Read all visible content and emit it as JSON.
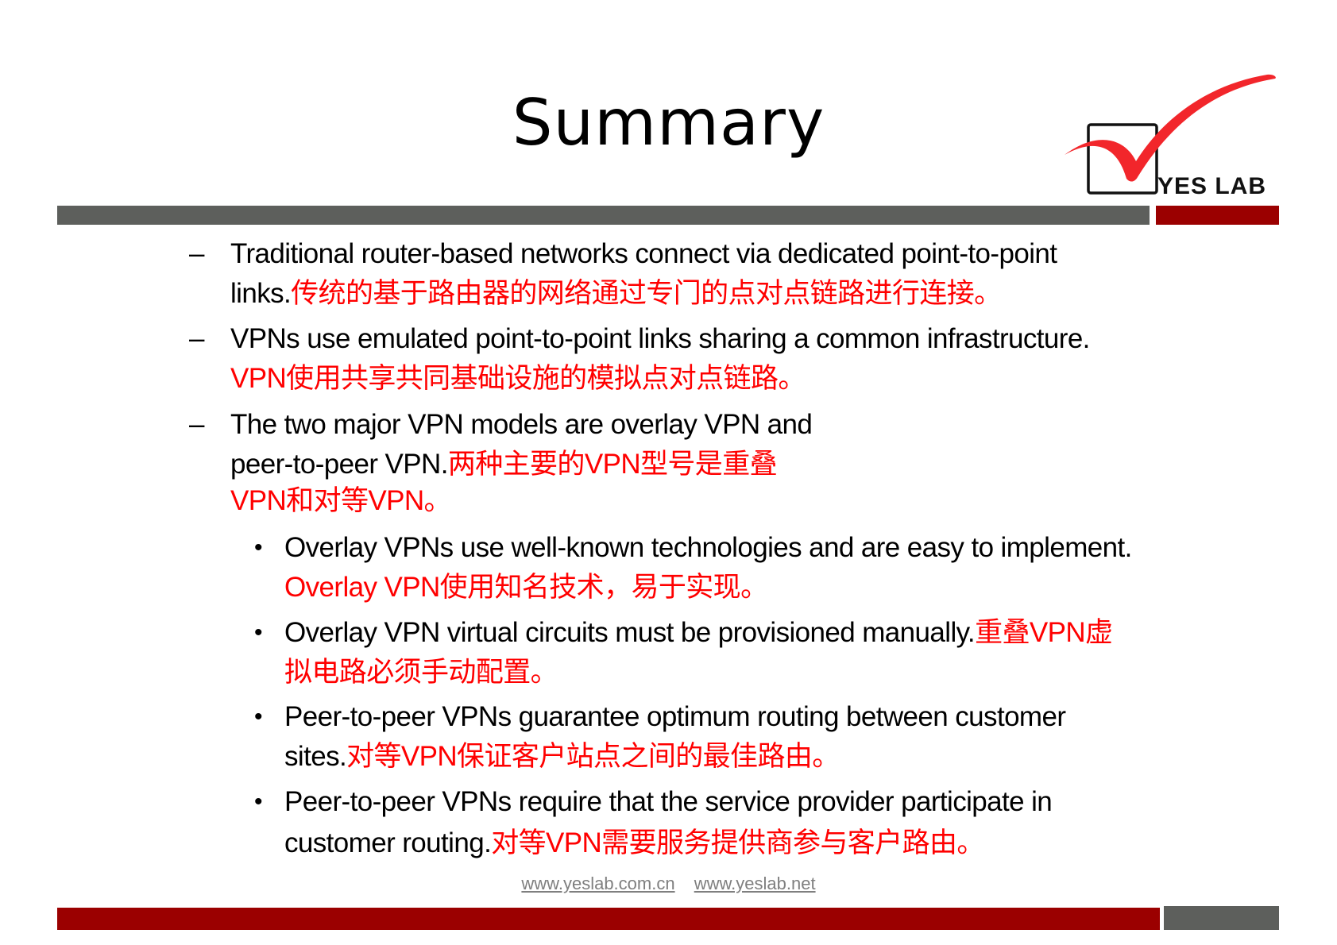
{
  "slide": {
    "title": "Summary",
    "logo": {
      "text": "YES LAB",
      "icon": "checkmark-box-icon"
    },
    "colors": {
      "accent_red": "#9b0000",
      "bar_grey": "#5d5f5c",
      "translation_red": "#ff0000",
      "check_red": "#f2262b"
    },
    "items": [
      {
        "level": 1,
        "marker": "–",
        "lines": [
          {
            "en": "Traditional router-based networks connect via dedicated point-to-point",
            "zh": ""
          },
          {
            "en": "links.",
            "zh": "传统的基于路由器的网络通过专门的点对点链路进行连接。"
          }
        ]
      },
      {
        "level": 1,
        "marker": "–",
        "lines": [
          {
            "en": "VPNs use emulated point-to-point links sharing a common infrastructure.",
            "zh": ""
          },
          {
            "en": "",
            "zh": "VPN使用共享共同基础设施的模拟点对点链路。"
          }
        ]
      },
      {
        "level": 1,
        "marker": "–",
        "lines": [
          {
            "en": "The two major VPN  models are overlay VPN and",
            "zh": ""
          },
          {
            "en": "peer-to-peer VPN.",
            "zh": "两种主要的VPN型号是重叠"
          },
          {
            "en": "",
            "zh": "VPN和对等VPN。"
          }
        ]
      },
      {
        "level": 2,
        "marker": "•",
        "lines": [
          {
            "en": "Overlay VPNs  use well-known technologies and are easy to implement.",
            "zh": ""
          },
          {
            "en": "",
            "zh": "Overlay VPN使用知名技术，易于实现。"
          }
        ]
      },
      {
        "level": 2,
        "marker": "•",
        "lines": [
          {
            "en": "Overlay VPN  virtual circuits must be provisioned manually.",
            "zh": "重叠VPN虚"
          },
          {
            "en": "",
            "zh": "拟电路必须手动配置。"
          }
        ]
      },
      {
        "level": 2,
        "marker": "•",
        "lines": [
          {
            "en": "Peer-to-peer VPNs  guarantee optimum routing between customer",
            "zh": ""
          },
          {
            "en": "sites.",
            "zh": "对等VPN保证客户站点之间的最佳路由。"
          }
        ]
      },
      {
        "level": 2,
        "marker": "•",
        "lines": [
          {
            "en": "Peer-to-peer VPNs  require that the service  provider participate in",
            "zh": ""
          },
          {
            "en": "customer routing.",
            "zh": "对等VPN需要服务提供商参与客户路由。"
          }
        ]
      }
    ],
    "footer": {
      "link1": "www.yeslab.com.cn",
      "link2": "www.yeslab.net"
    }
  }
}
